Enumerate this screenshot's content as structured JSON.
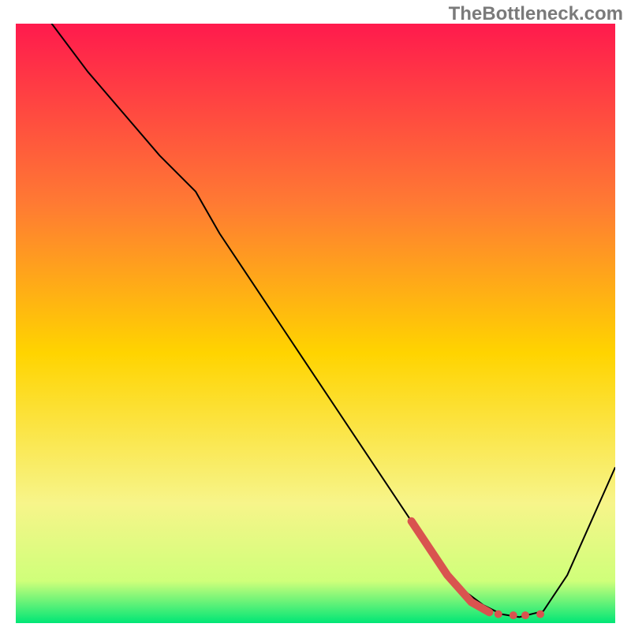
{
  "watermark": "TheBottleneck.com",
  "chart_data": {
    "type": "line",
    "title": "",
    "xlabel": "",
    "ylabel": "",
    "xlim": [
      0,
      100
    ],
    "ylim": [
      0,
      100
    ],
    "grid": false,
    "legend": false,
    "background_gradient": {
      "top": "#ff1a4d",
      "upper_mid": "#ff7a33",
      "mid": "#ffd400",
      "lower_mid": "#f7f58a",
      "near_bottom": "#cfff7a",
      "bottom": "#00e676"
    },
    "series": [
      {
        "name": "bottleneck-curve",
        "type": "line",
        "color": "#000000",
        "width": 2,
        "x": [
          0,
          6,
          12,
          18,
          24,
          30,
          34,
          38,
          44,
          50,
          56,
          62,
          68,
          74,
          78,
          81,
          84,
          88,
          92,
          96,
          100
        ],
        "y": [
          108,
          100,
          92,
          85,
          78,
          72,
          65,
          59,
          50,
          41,
          32,
          23,
          14,
          6,
          3,
          1.5,
          1,
          2,
          8,
          17,
          26
        ]
      },
      {
        "name": "highlight-segment",
        "type": "line",
        "color": "#d9534f",
        "width": 10,
        "linecap": "round",
        "x": [
          66,
          72,
          76,
          79
        ],
        "y": [
          17,
          8,
          3.5,
          1.8
        ]
      },
      {
        "name": "highlight-dots",
        "type": "scatter",
        "color": "#d9534f",
        "radius": 5,
        "x": [
          80.5,
          83,
          85,
          87.5
        ],
        "y": [
          1.5,
          1.3,
          1.3,
          1.5
        ]
      }
    ]
  }
}
